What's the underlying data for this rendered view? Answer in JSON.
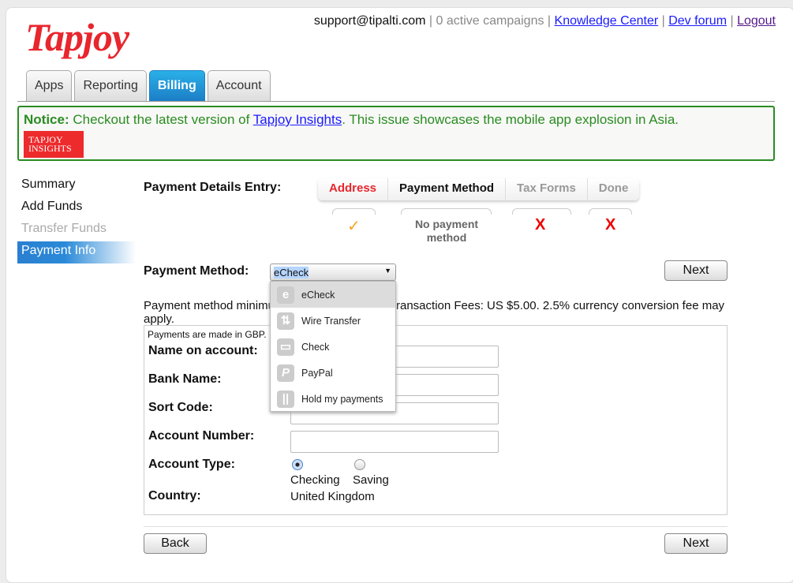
{
  "header": {
    "logo": "Tapjoy",
    "email": "support@tipalti.com",
    "campaigns": "0 active campaigns",
    "links": [
      "Knowledge Center",
      "Dev forum",
      "Logout"
    ]
  },
  "tabs": [
    {
      "label": "Apps"
    },
    {
      "label": "Reporting"
    },
    {
      "label": "Billing",
      "active": true
    },
    {
      "label": "Account"
    }
  ],
  "notice": {
    "label": "Notice:",
    "text1": "Checkout the latest version of",
    "link": "Tapjoy Insights",
    "text2": ". This issue showcases the mobile app explosion in Asia.",
    "badge": "TAPJOY INSIGHTS"
  },
  "sidebar": {
    "items": [
      {
        "label": "Summary"
      },
      {
        "label": "Add Funds"
      },
      {
        "label": "Transfer Funds",
        "disabled": true
      },
      {
        "label": "Payment Info",
        "active": true
      }
    ]
  },
  "steps": {
    "title": "Payment Details Entry:",
    "items": [
      {
        "label": "Address",
        "status": "✓"
      },
      {
        "label": "Payment Method",
        "status": "No payment method"
      },
      {
        "label": "Tax Forms",
        "status": "X"
      },
      {
        "label": "Done",
        "status": "X"
      }
    ]
  },
  "payment": {
    "label": "Payment Method:",
    "selected": "eCheck",
    "options": [
      {
        "label": "eCheck",
        "icon": "e"
      },
      {
        "label": "Wire Transfer",
        "icon": "⇅"
      },
      {
        "label": "Check",
        "icon": "▭"
      },
      {
        "label": "PayPal",
        "icon": "P"
      },
      {
        "label": "Hold my payments",
        "icon": "||"
      }
    ],
    "info_a": "Payment method minimu",
    "info_b": "ransaction Fees: US $5.00. 2.5% currency conversion fee may",
    "info_c": "apply."
  },
  "form": {
    "currency_note": "Payments are made in GBP.",
    "name": "Name on account:",
    "bank": "Bank Name:",
    "sort": "Sort Code:",
    "acct": "Account Number:",
    "type": "Account Type:",
    "checking": "Checking",
    "saving": "Saving",
    "country_label": "Country:",
    "country": "United Kingdom"
  },
  "buttons": {
    "next": "Next",
    "back": "Back"
  },
  "colors": {
    "accent": "#1c7ec6",
    "brand": "#e8262d",
    "notice": "#2a8c22"
  }
}
